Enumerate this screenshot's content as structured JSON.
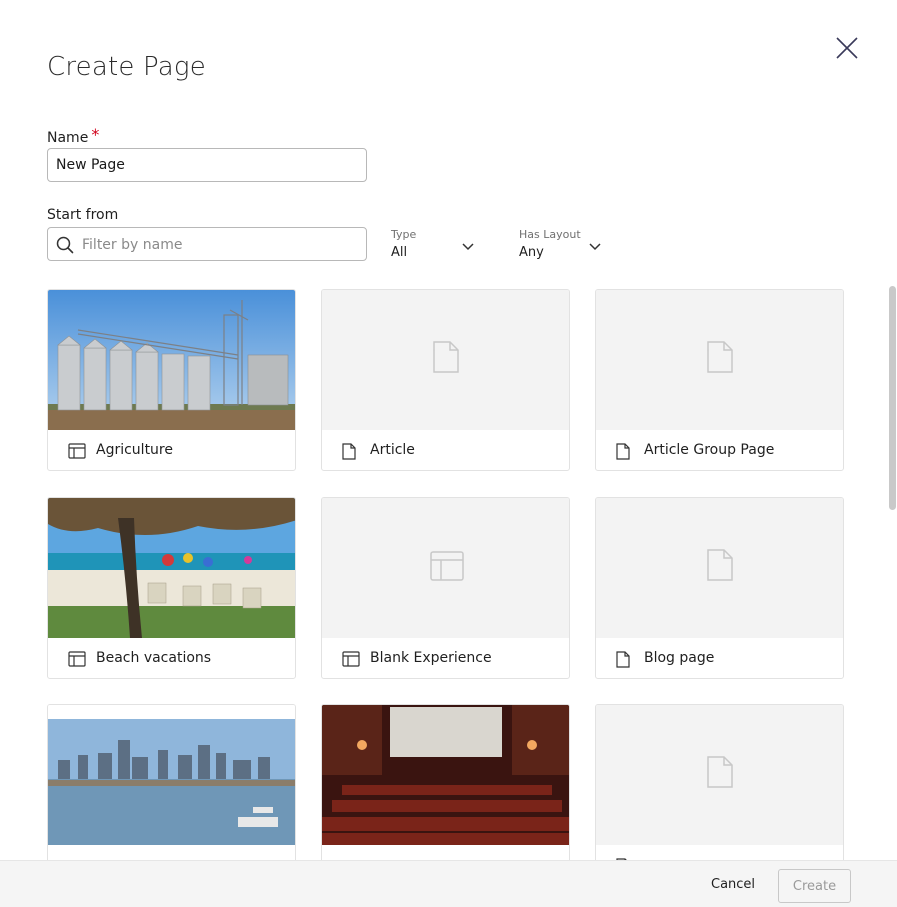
{
  "dialog": {
    "title": "Create Page"
  },
  "name_field": {
    "label": "Name",
    "required_mark": "*",
    "value": "New Page"
  },
  "start_from": {
    "label": "Start from",
    "search_placeholder": "Filter by name",
    "filters": [
      {
        "label": "Type",
        "value": "All"
      },
      {
        "label": "Has Layout",
        "value": "Any"
      }
    ]
  },
  "templates": [
    {
      "name": "Agriculture",
      "icon": "layout-icon",
      "thumbnail": "grain-silos-photo"
    },
    {
      "name": "Article",
      "icon": "page-icon",
      "thumbnail": "placeholder"
    },
    {
      "name": "Article Group Page",
      "icon": "page-icon",
      "thumbnail": "placeholder"
    },
    {
      "name": "Beach vacations",
      "icon": "layout-icon",
      "thumbnail": "beach-photo"
    },
    {
      "name": "Blank Experience",
      "icon": "layout-icon",
      "thumbnail": "placeholder"
    },
    {
      "name": "Blog page",
      "icon": "page-icon",
      "thumbnail": "placeholder"
    },
    {
      "name": "",
      "icon": "layout-icon",
      "thumbnail": "city-skyline-photo"
    },
    {
      "name": "",
      "icon": "layout-icon",
      "thumbnail": "movie-theater-photo"
    },
    {
      "name": "",
      "icon": "page-icon",
      "thumbnail": "placeholder"
    }
  ],
  "footer": {
    "cancel_label": "Cancel",
    "create_label": "Create"
  }
}
